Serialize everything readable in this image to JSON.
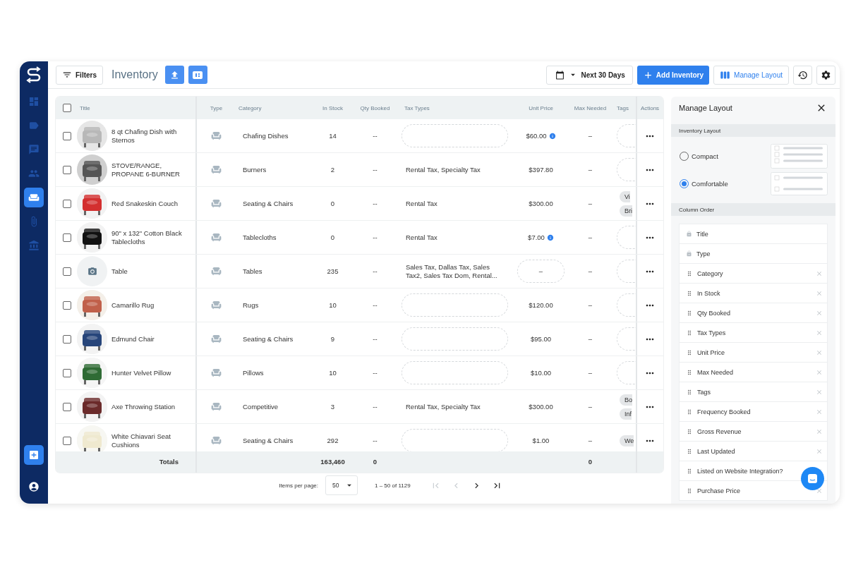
{
  "header": {
    "filters": "Filters",
    "title": "Inventory",
    "date_range": "Next 30 Days",
    "add_button": "Add Inventory",
    "layout_button": "Manage Layout"
  },
  "sidebar": {
    "items": [
      {
        "selected": false
      },
      {
        "selected": false
      },
      {
        "selected": false
      },
      {
        "selected": false
      },
      {
        "selected": true
      },
      {
        "selected": false
      },
      {
        "selected": false
      }
    ]
  },
  "table": {
    "all_checked": false,
    "columns": [
      "Title",
      "Type",
      "Category",
      "In Stock",
      "Qty Booked",
      "Tax Types",
      "Unit Price",
      "Max Needed",
      "Tags",
      "Actions"
    ],
    "rows": [
      {
        "has_photo": true,
        "title": "8 qt Chafing Dish with Sternos",
        "category": "Chafing Dishes",
        "in_stock": "14",
        "qty_booked": "--",
        "unit_price": "$60.00",
        "price_info": true,
        "price_field": false,
        "max_needed": "–",
        "tags": [],
        "checked": false
      },
      {
        "has_photo": true,
        "title": "STOVE/RANGE, PROPANE 6-BURNER",
        "category": "Burners",
        "in_stock": "2",
        "qty_booked": "--",
        "tax_types": "Rental Tax, Specialty Tax",
        "unit_price": "$397.80",
        "price_info": false,
        "price_field": false,
        "max_needed": "–",
        "tags": [],
        "checked": false
      },
      {
        "has_photo": true,
        "title": "Red Snakeskin Couch",
        "category": "Seating & Chairs",
        "in_stock": "0",
        "qty_booked": "--",
        "tax_types": "Rental Tax",
        "unit_price": "$300.00",
        "price_info": false,
        "price_field": false,
        "max_needed": "–",
        "tags": [
          "Vi",
          "Bri"
        ],
        "checked": false
      },
      {
        "has_photo": true,
        "title": "90\" x 132\" Cotton Black Tablecloths",
        "category": "Tablecloths",
        "in_stock": "0",
        "qty_booked": "--",
        "tax_types": "Rental Tax",
        "unit_price": "$7.00",
        "price_info": true,
        "price_field": false,
        "max_needed": "–",
        "tags": [],
        "checked": false
      },
      {
        "has_photo": false,
        "title": "Table",
        "category": "Tables",
        "in_stock": "235",
        "qty_booked": "--",
        "tax_types": "Sales Tax, Dallas Tax, Sales Tax2, Sales Tax Dom, Rental...",
        "unit_price": "–",
        "price_info": false,
        "price_field": true,
        "max_needed": "–",
        "tags": [],
        "checked": false
      },
      {
        "has_photo": true,
        "title": "Camarillo Rug",
        "category": "Rugs",
        "in_stock": "10",
        "qty_booked": "--",
        "unit_price": "$120.00",
        "price_info": false,
        "price_field": false,
        "max_needed": "–",
        "tags": [],
        "checked": false
      },
      {
        "has_photo": true,
        "title": "Edmund Chair",
        "category": "Seating & Chairs",
        "in_stock": "9",
        "qty_booked": "--",
        "unit_price": "$95.00",
        "price_info": false,
        "price_field": false,
        "max_needed": "–",
        "tags": [],
        "checked": false
      },
      {
        "has_photo": true,
        "title": "Hunter Velvet Pillow",
        "category": "Pillows",
        "in_stock": "10",
        "qty_booked": "--",
        "unit_price": "$10.00",
        "price_info": false,
        "price_field": false,
        "max_needed": "–",
        "tags": [],
        "checked": false
      },
      {
        "has_photo": true,
        "title": "Axe Throwing Station",
        "category": "Competitive",
        "in_stock": "3",
        "qty_booked": "--",
        "tax_types": "Rental Tax, Specialty Tax",
        "unit_price": "$300.00",
        "price_info": false,
        "price_field": false,
        "max_needed": "–",
        "tags": [
          "Bo",
          "Inf"
        ],
        "checked": false
      },
      {
        "has_photo": true,
        "title": "White Chiavari Seat Cushions",
        "category": "Seating & Chairs",
        "in_stock": "292",
        "qty_booked": "--",
        "unit_price": "$1.00",
        "price_info": false,
        "price_field": false,
        "max_needed": "–",
        "tags": [
          "We"
        ],
        "checked": false
      }
    ],
    "totals": {
      "label": "Totals",
      "in_stock": "163,460",
      "qty_booked": "0",
      "max_needed": "0"
    }
  },
  "pagination": {
    "label": "Items per page:",
    "per_page": "50",
    "range": "1 – 50 of 1129"
  },
  "panel": {
    "title": "Manage Layout",
    "layout_heading": "Inventory Layout",
    "layouts": [
      {
        "label": "Compact",
        "selected": false
      },
      {
        "label": "Comfortable",
        "selected": true
      }
    ],
    "order_heading": "Column Order",
    "columns": [
      {
        "label": "Title",
        "kind": "locked"
      },
      {
        "label": "Type",
        "kind": "locked"
      },
      {
        "label": "Category",
        "kind": "movable"
      },
      {
        "label": "In Stock",
        "kind": "movable"
      },
      {
        "label": "Qty Booked",
        "kind": "movable"
      },
      {
        "label": "Tax Types",
        "kind": "movable"
      },
      {
        "label": "Unit Price",
        "kind": "movable"
      },
      {
        "label": "Max Needed",
        "kind": "movable"
      },
      {
        "label": "Tags",
        "kind": "movable"
      },
      {
        "label": "Frequency Booked",
        "kind": "movable"
      },
      {
        "label": "Gross Revenue",
        "kind": "movable"
      },
      {
        "label": "Last Updated",
        "kind": "movable"
      },
      {
        "label": "Listed on Website Integration?",
        "kind": "movable"
      },
      {
        "label": "Purchase Price",
        "kind": "movable"
      }
    ]
  }
}
